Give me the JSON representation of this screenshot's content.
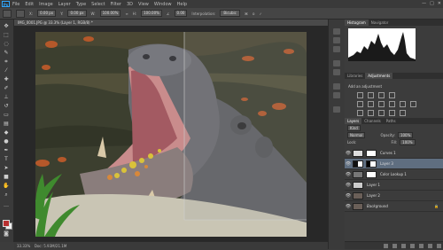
{
  "app": {
    "logo": "Ps"
  },
  "menu": [
    "File",
    "Edit",
    "Image",
    "Layer",
    "Type",
    "Select",
    "Filter",
    "3D",
    "View",
    "Window",
    "Help"
  ],
  "window_controls": [
    "—",
    "□",
    "✕"
  ],
  "options": {
    "x_label": "X:",
    "x_value": "0.00 px",
    "y_label": "Y:",
    "w_label": "W:",
    "w_value": "100.00%",
    "h_label": "H:",
    "h_value": "100.00%",
    "angle_label": "∠",
    "angle_value": "0.00",
    "interp_label": "Interpolation:",
    "interp_value": "Bicubic"
  },
  "document": {
    "tab_title": "IMG_0001.JPG @ 33.3% (Layer 1, RGB/8) *",
    "zoom": "33.33%",
    "doc_info": "Doc: 5.93M/21.1M"
  },
  "panels": {
    "top_tabs": [
      "Histogram",
      "Navigator"
    ],
    "adj_tabs": [
      "Libraries",
      "Adjustments"
    ],
    "adj_title": "Add an adjustment",
    "layer_tabs": [
      "Layers",
      "Channels",
      "Paths"
    ],
    "kind_label": "Kind",
    "blend_mode": "Normal",
    "opacity_label": "Opacity:",
    "opacity_value": "100%",
    "lock_label": "Lock:",
    "fill_label": "Fill:",
    "fill_value": "100%"
  },
  "layers": [
    {
      "name": "Curves 1",
      "selected": false
    },
    {
      "name": "Layer 3",
      "selected": true
    },
    {
      "name": "Color Lookup 1",
      "selected": false
    },
    {
      "name": "Layer 1",
      "selected": false
    },
    {
      "name": "Layer 2",
      "selected": false
    },
    {
      "name": "Background",
      "selected": false
    }
  ],
  "colors": {
    "accent": "#31a8ff",
    "selection": "#5f6e80",
    "fg_color": "#b83030",
    "bg_color": "#f0f0f0"
  }
}
